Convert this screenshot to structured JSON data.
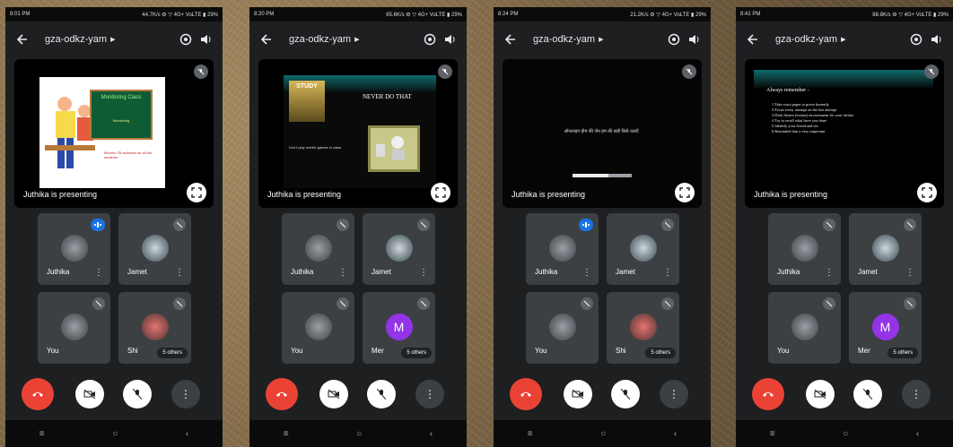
{
  "phones": [
    {
      "status": {
        "time": "8:01 PM",
        "right": "44.7K/s ⚙ ▽ 4G+ VoLTE ▮ 29%"
      },
      "meeting_code": "gza-odkz-yam",
      "presenter_label": "Juthika is presenting",
      "slide": {
        "board_title": "Monitoring Class",
        "board_subtitle": "Monitoring",
        "text_lines": "Monitor Oll activities for all the students"
      },
      "tiles": [
        {
          "name": "Juthika",
          "state": "active"
        },
        {
          "name": "Jamet",
          "state": "muted"
        },
        {
          "name": "You",
          "state": "muted"
        },
        {
          "name": "Shi",
          "others": "5 others",
          "state": "muted"
        }
      ]
    },
    {
      "status": {
        "time": "8:20 PM",
        "right": "65.6K/s ⚙ ▽ 4G+ VoLTE ▮ 29%"
      },
      "meeting_code": "gza-odkz-yam",
      "presenter_label": "Juthika is presenting",
      "slide": {
        "left_label": "STUDY",
        "heading": "NEVER DO THAT",
        "caption": "Don't play mobile games in class"
      },
      "tiles": [
        {
          "name": "Juthika",
          "state": "muted"
        },
        {
          "name": "Jamet",
          "state": "muted"
        },
        {
          "name": "You",
          "state": "muted"
        },
        {
          "name": "Mer",
          "others": "5 others",
          "letter": "M",
          "state": "muted"
        }
      ]
    },
    {
      "status": {
        "time": "8:24 PM",
        "right": "21.2K/s ⚙ ▽ 4G+ VoLTE ▮ 29%"
      },
      "meeting_code": "gza-odkz-yam",
      "presenter_label": "Juthika is presenting",
      "slide": {
        "text": "ऑनलाइन होम की जेन हम की सही किये उठाएँ"
      },
      "tiles": [
        {
          "name": "Juthika",
          "state": "active"
        },
        {
          "name": "Jamet",
          "state": "muted"
        },
        {
          "name": "You",
          "state": "muted"
        },
        {
          "name": "Shi",
          "others": "5 others",
          "state": "muted"
        }
      ]
    },
    {
      "status": {
        "time": "8:41 PM",
        "right": "88.8K/s ⚙ ▽ 4G+ VoLTE ▮ 29%"
      },
      "meeting_code": "gza-odkz-yam",
      "presenter_label": "Juthika is presenting",
      "slide": {
        "heading": "Always remember -",
        "items": [
          "1 Take extra paper to prove honestly",
          "2 Focus every attempt on the last attempt",
          "3 Desk fitness (exams) environment for your failure",
          "4 Try to recall what have you done",
          "5 Identify your friend and tea",
          "6 Reminded him a very important"
        ]
      },
      "tiles": [
        {
          "name": "Juthika",
          "state": "muted"
        },
        {
          "name": "Jamet",
          "state": "muted"
        },
        {
          "name": "You",
          "state": "muted"
        },
        {
          "name": "Mer",
          "others": "5 others",
          "letter": "M",
          "state": "muted"
        }
      ]
    }
  ]
}
